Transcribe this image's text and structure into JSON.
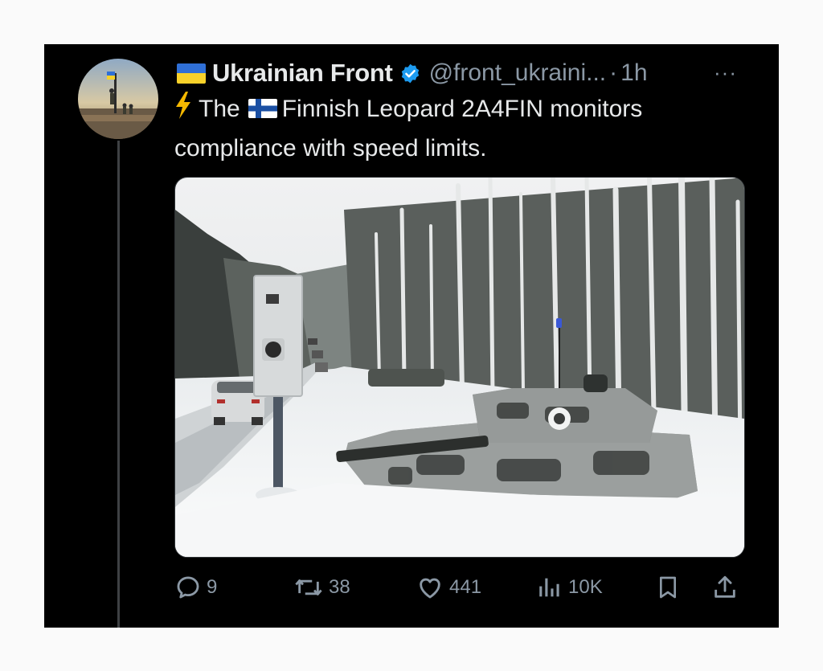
{
  "author": {
    "flag_icon": "ukraine-flag-icon",
    "name": "Ukrainian Front",
    "verified_icon": "verified-badge-icon",
    "handle": "@front_ukraini...",
    "separator": " · ",
    "time": "1h"
  },
  "more_icon": "more-horizontal-icon",
  "more_label": "···",
  "tweet": {
    "bolt_icon": "lightning-bolt-icon",
    "text_lead": "The",
    "flag_icon": "finland-flag-icon",
    "text_body": "Finnish Leopard 2A4FIN monitors compliance with speed limits."
  },
  "media": {
    "alt_description": "",
    "icon": "photo-media"
  },
  "actions": {
    "reply": {
      "icon": "reply-icon",
      "count": "9"
    },
    "retweet": {
      "icon": "retweet-icon",
      "count": "38"
    },
    "like": {
      "icon": "heart-icon",
      "count": "441"
    },
    "views": {
      "icon": "views-icon",
      "count": "10K"
    },
    "bookmark": {
      "icon": "bookmark-icon"
    },
    "share": {
      "icon": "share-icon"
    }
  },
  "colors": {
    "background": "#000000",
    "text": "#e7e9ea",
    "muted": "#8b98a5",
    "verified": "#1d9bf0"
  }
}
